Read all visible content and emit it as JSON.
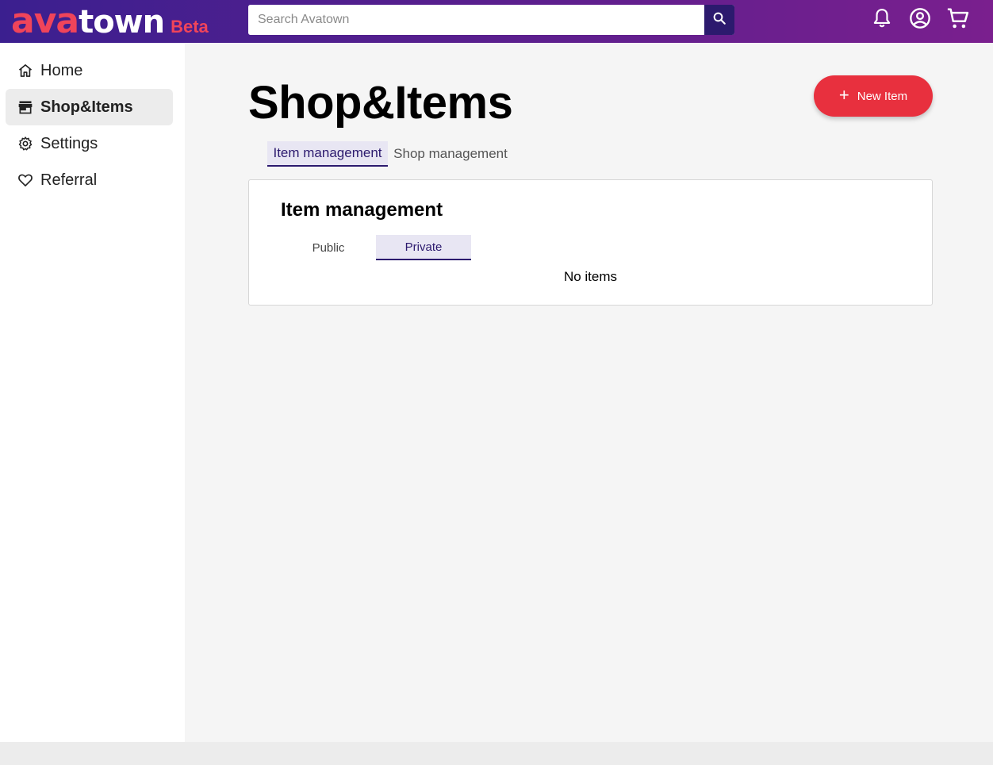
{
  "header": {
    "logo": {
      "part1": "ava",
      "part2": "town",
      "badge": "Beta"
    },
    "search": {
      "placeholder": "Search Avatown",
      "value": ""
    },
    "icons": [
      "search-icon",
      "bell-icon",
      "account-circle-icon",
      "cart-icon"
    ]
  },
  "sidebar": {
    "items": [
      {
        "label": "Home",
        "icon": "home-icon",
        "active": false
      },
      {
        "label": "Shop&Items",
        "icon": "store-icon",
        "active": true
      },
      {
        "label": "Settings",
        "icon": "gear-icon",
        "active": false
      },
      {
        "label": "Referral",
        "icon": "heart-icon",
        "active": false
      }
    ]
  },
  "main": {
    "title": "Shop&Items",
    "new_button_label": "New Item",
    "tabs": [
      {
        "label": "Item management",
        "active": true
      },
      {
        "label": "Shop management",
        "active": false
      }
    ],
    "card": {
      "title": "Item management",
      "subtabs": [
        {
          "label": "Public",
          "active": false
        },
        {
          "label": "Private",
          "active": true
        }
      ],
      "empty_message": "No items"
    }
  },
  "colors": {
    "header_gradient_start": "#3b1f8f",
    "header_gradient_end": "#7a1f8e",
    "accent_red": "#e8303e",
    "accent_indigo": "#2c1a6e"
  }
}
